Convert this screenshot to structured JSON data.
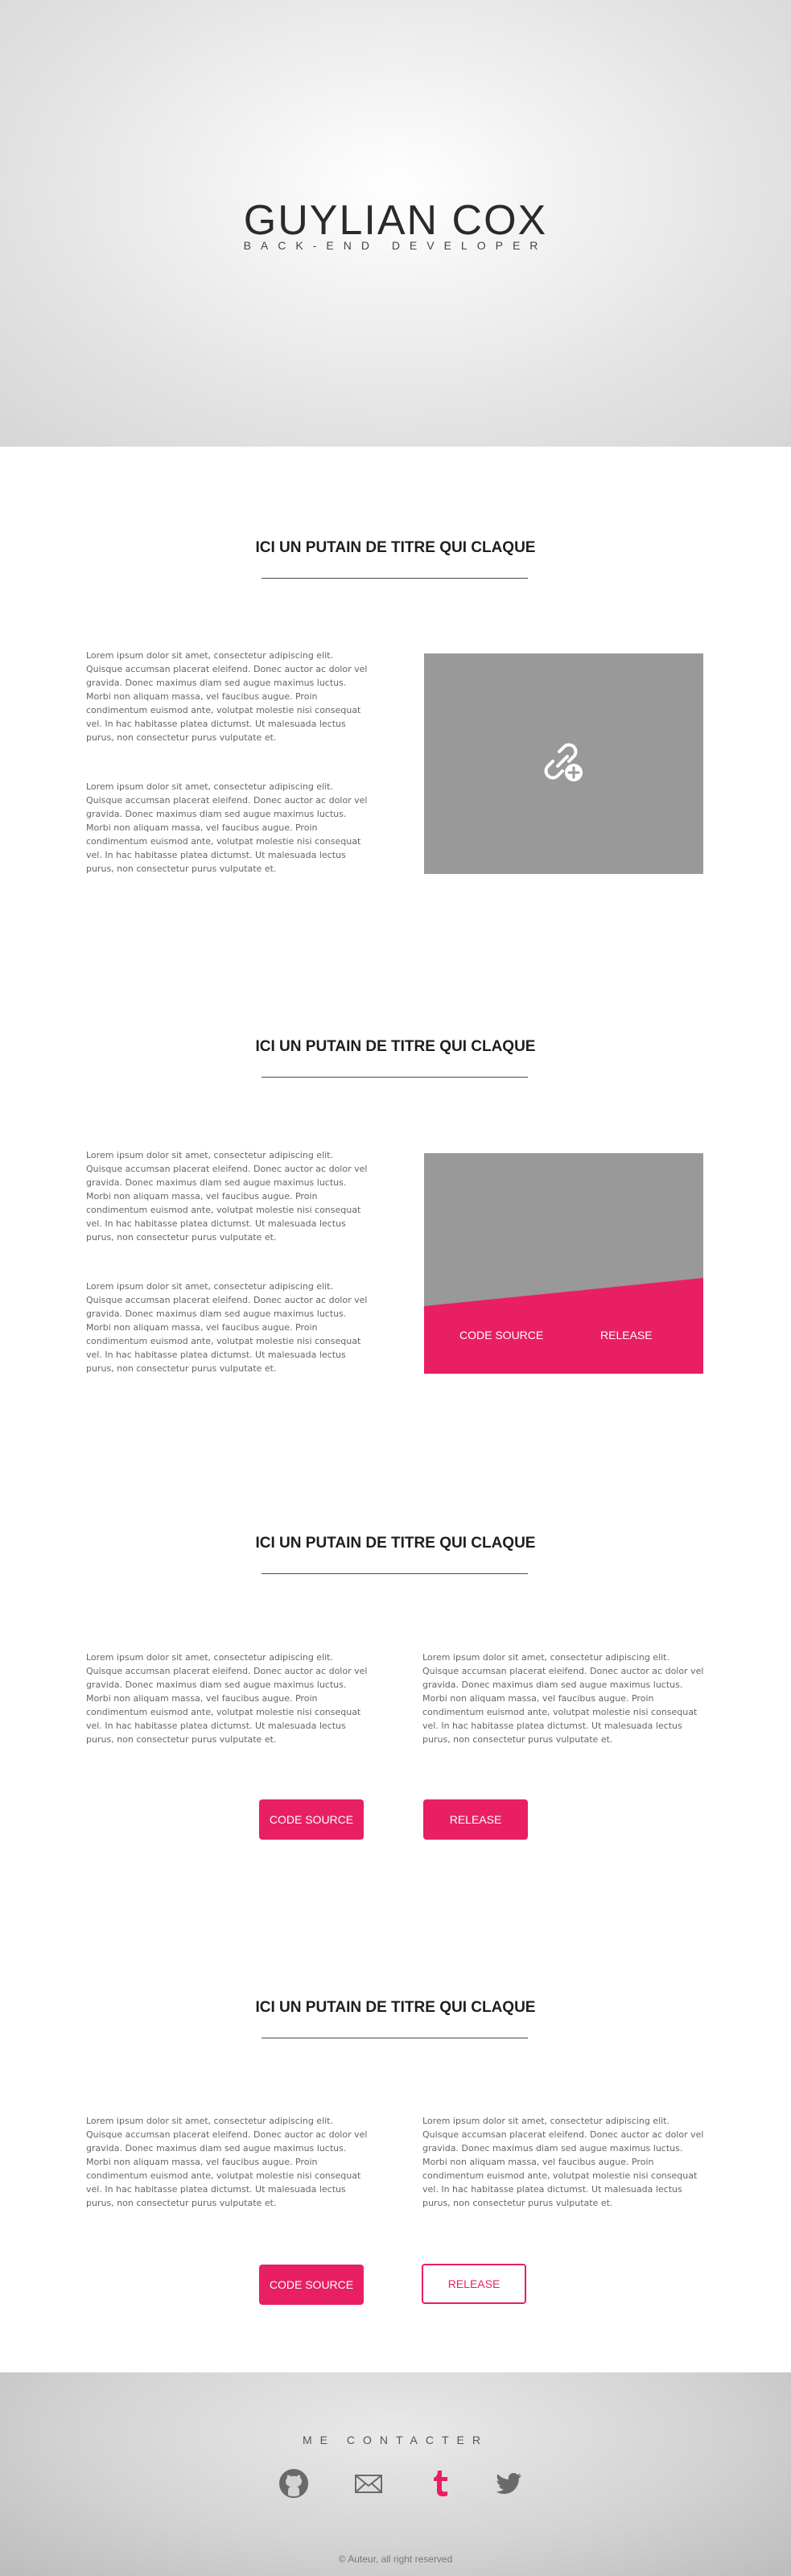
{
  "hero": {
    "name": "GUYLIAN COX",
    "subtitle": "BACK-END DEVELOPER"
  },
  "sections": [
    {
      "title": "ICI UN PUTAIN DE TITRE QUI CLAQUE",
      "paragraphs": [
        "Lorem ipsum dolor sit amet, consectetur adipiscing elit. Quisque accumsan placerat eleifend. Donec auctor ac dolor vel gravida. Donec maximus diam sed augue maximus luctus. Morbi non aliquam massa, vel faucibus augue. Proin condimentum euismod ante, volutpat molestie nisi consequat vel. In hac habitasse platea dictumst. Ut malesuada lectus purus, non consectetur purus vulputate et.",
        "Lorem ipsum dolor sit amet, consectetur adipiscing elit. Quisque accumsan placerat eleifend. Donec auctor ac dolor vel gravida. Donec maximus diam sed augue maximus luctus. Morbi non aliquam massa, vel faucibus augue. Proin condimentum euismod ante, volutpat molestie nisi consequat vel. In hac habitasse platea dictumst. Ut malesuada lectus purus, non consectetur purus vulputate et."
      ],
      "media_icon": "link-add-icon"
    },
    {
      "title": "ICI UN PUTAIN DE TITRE QUI CLAQUE",
      "paragraphs": [
        "Lorem ipsum dolor sit amet, consectetur adipiscing elit. Quisque accumsan placerat eleifend. Donec auctor ac dolor vel gravida. Donec maximus diam sed augue maximus luctus. Morbi non aliquam massa, vel faucibus augue. Proin condimentum euismod ante, volutpat molestie nisi consequat vel. In hac habitasse platea dictumst. Ut malesuada lectus purus, non consectetur purus vulputate et.",
        "Lorem ipsum dolor sit amet, consectetur adipiscing elit. Quisque accumsan placerat eleifend. Donec auctor ac dolor vel gravida. Donec maximus diam sed augue maximus luctus. Morbi non aliquam massa, vel faucibus augue. Proin condimentum euismod ante, volutpat molestie nisi consequat vel. In hac habitasse platea dictumst. Ut malesuada lectus purus, non consectetur purus vulputate et."
      ],
      "code_source_label": "CODE SOURCE",
      "release_label": "RELEASE"
    },
    {
      "title": "ICI UN PUTAIN DE TITRE QUI CLAQUE",
      "paragraphs": [
        "Lorem ipsum dolor sit amet, consectetur adipiscing elit. Quisque accumsan placerat eleifend. Donec auctor ac dolor vel gravida. Donec maximus diam sed augue maximus luctus. Morbi non aliquam massa, vel faucibus augue. Proin condimentum euismod ante, volutpat molestie nisi consequat vel. In hac habitasse platea dictumst. Ut malesuada lectus purus, non consectetur purus vulputate et.",
        "Lorem ipsum dolor sit amet, consectetur adipiscing elit. Quisque accumsan placerat eleifend. Donec auctor ac dolor vel gravida. Donec maximus diam sed augue maximus luctus. Morbi non aliquam massa, vel faucibus augue. Proin condimentum euismod ante, volutpat molestie nisi consequat vel. In hac habitasse platea dictumst. Ut malesuada lectus purus, non consectetur purus vulputate et."
      ],
      "code_source_label": "CODE SOURCE",
      "release_label": "RELEASE"
    },
    {
      "title": "ICI UN PUTAIN DE TITRE QUI CLAQUE",
      "paragraphs": [
        "Lorem ipsum dolor sit amet, consectetur adipiscing elit. Quisque accumsan placerat eleifend. Donec auctor ac dolor vel gravida. Donec maximus diam sed augue maximus luctus. Morbi non aliquam massa, vel faucibus augue. Proin condimentum euismod ante, volutpat molestie nisi consequat vel. In hac habitasse platea dictumst. Ut malesuada lectus purus, non consectetur purus vulputate et.",
        "Lorem ipsum dolor sit amet, consectetur adipiscing elit. Quisque accumsan placerat eleifend. Donec auctor ac dolor vel gravida. Donec maximus diam sed augue maximus luctus. Morbi non aliquam massa, vel faucibus augue. Proin condimentum euismod ante, volutpat molestie nisi consequat vel. In hac habitasse platea dictumst. Ut malesuada lectus purus, non consectetur purus vulputate et."
      ],
      "code_source_label": "CODE SOURCE",
      "release_label": "RELEASE"
    }
  ],
  "footer": {
    "contact_title": "ME CONTACTER",
    "social_icons": [
      "github-icon",
      "mail-icon",
      "tumblr-icon",
      "twitter-icon"
    ],
    "copyright": "© Auteur, all right reserved"
  },
  "colors": {
    "accent": "#e81f63",
    "media_gray": "#999999",
    "text": "#666666"
  }
}
